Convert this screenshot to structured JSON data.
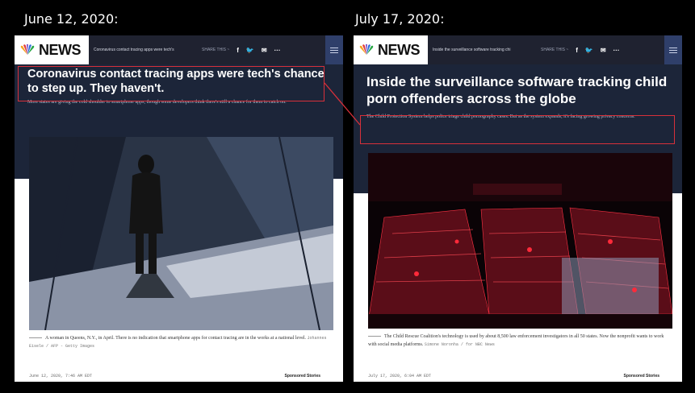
{
  "left": {
    "date": "June 12, 2020:",
    "nav": {
      "logo": "NEWS",
      "headline": "Coronavirus contact tracing apps were tech's",
      "share": "SHARE  THIS ~",
      "icons": [
        "facebook-icon",
        "twitter-icon",
        "email-icon",
        "more-icon"
      ]
    },
    "headline": "Coronavirus contact tracing apps were tech's chance to step up. They haven't.",
    "subheadline": "More states are giving the cold shoulder to smartphone apps, though some developers think there's still a chance for them to catch on.",
    "caption": "A woman in Queens, N.Y., in April. There is no indication that smartphone apps for contact tracing are in the works at a national level.",
    "credit": "Johannes Eisele / AFP - Getty Images",
    "timestamp": "June 12, 2020, 7:46 AM EDT",
    "sponsored": "Sponsored Stories"
  },
  "right": {
    "date": "July 17, 2020:",
    "nav": {
      "logo": "NEWS",
      "headline": "Inside the surveillance software tracking chi",
      "share": "SHARE  THIS ~",
      "icons": [
        "facebook-icon",
        "twitter-icon",
        "email-icon",
        "more-icon"
      ]
    },
    "headline": "Inside the surveillance software tracking child porn offenders across the globe",
    "subheadline": "The Child Protection System helps police triage child pornography cases. But as the system expands, it's facing growing privacy concerns.",
    "caption": "The Child Rescue Coalition's technology is used by about 8,500 law enforcement investigators in all 50 states. Now the nonprofit wants to work with social media platforms.",
    "credit": "Simone Noronha / for NBC News",
    "timestamp": "July 17, 2020, 6:04 AM EDT",
    "sponsored": "Sponsored Stories"
  },
  "colors": {
    "hero_bg": "#1c2539",
    "navbar_bg": "#1f2230",
    "highlight": "#d8303a"
  }
}
